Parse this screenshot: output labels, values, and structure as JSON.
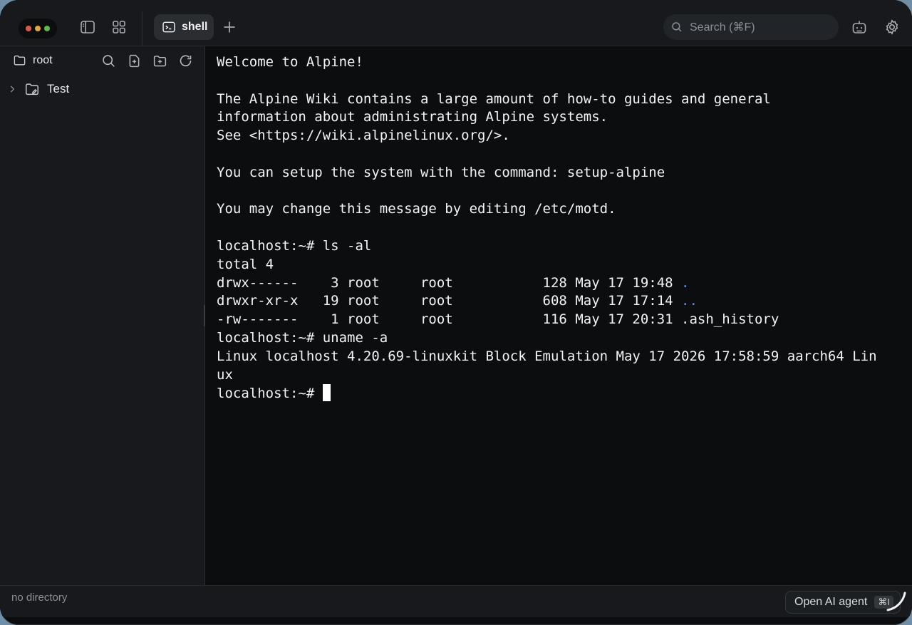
{
  "titlebar": {
    "tab_label": "shell",
    "search_placeholder": "Search (⌘F)"
  },
  "sidebar": {
    "root_label": "root",
    "items": [
      {
        "label": "Test",
        "expanded": false
      }
    ]
  },
  "terminal": {
    "lines": [
      {
        "text": "Welcome to Alpine!"
      },
      {
        "text": ""
      },
      {
        "text": "The Alpine Wiki contains a large amount of how-to guides and general"
      },
      {
        "text": "information about administrating Alpine systems."
      },
      {
        "text": "See <https://wiki.alpinelinux.org/>."
      },
      {
        "text": ""
      },
      {
        "text": "You can setup the system with the command: setup-alpine"
      },
      {
        "text": ""
      },
      {
        "text": "You may change this message by editing /etc/motd."
      },
      {
        "text": ""
      },
      {
        "text": "localhost:~# ls -al"
      },
      {
        "text": "total 4"
      },
      {
        "text": "drwx------    3 root     root           128 May 17 19:48 ",
        "suffix": "."
      },
      {
        "text": "drwxr-xr-x   19 root     root           608 May 17 17:14 ",
        "suffix": ".."
      },
      {
        "text": "-rw-------    1 root     root           116 May 17 20:31 .ash_history"
      },
      {
        "text": "localhost:~# uname -a"
      },
      {
        "text": "Linux localhost 4.20.69-linuxkit Block Emulation May 17 2026 17:58:59 aarch64 Lin"
      },
      {
        "text": "ux"
      }
    ],
    "prompt": "localhost:~# ",
    "dir_link_color": "#5c8ff2"
  },
  "statusbar": {
    "directory_text": "no directory",
    "ai_button_label": "Open AI agent",
    "ai_shortcut": "⌘I"
  }
}
